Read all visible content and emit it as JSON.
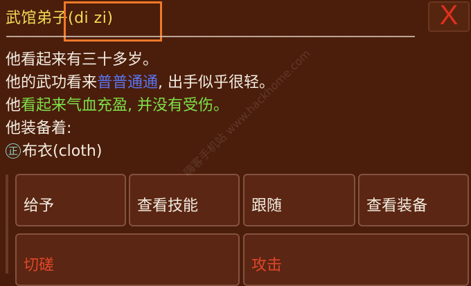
{
  "title": "武馆弟子(di zi)",
  "divider": "———————————————————————————————",
  "close_label": "X",
  "lines": {
    "age": "他看起来有三十多岁。",
    "skill_prefix": "他的武功看来",
    "skill_level": "普普通通",
    "skill_suffix": ", 出手似乎很轻。",
    "health_prefix": "他",
    "health_status": "看起来气血充盈, 并没有受伤。",
    "equip_heading": "他装备着:",
    "equip_badge": "正",
    "equip_item": "布衣(cloth)"
  },
  "buttons": {
    "give": "给予",
    "view_skills": "查看技能",
    "follow": "跟随",
    "view_equipment": "查看装备",
    "spar": "切磋",
    "attack": "攻击"
  },
  "watermark": "嗨客手机站 www.hackhome.com",
  "colors": {
    "background": "#4b1d0b",
    "title": "#f2dc58",
    "text": "#f2ece0",
    "skill_level": "#5a74f2",
    "health_status": "#7ce14a",
    "danger": "#e0462a",
    "highlight": "#f07a2a",
    "close": "#e0301e"
  }
}
